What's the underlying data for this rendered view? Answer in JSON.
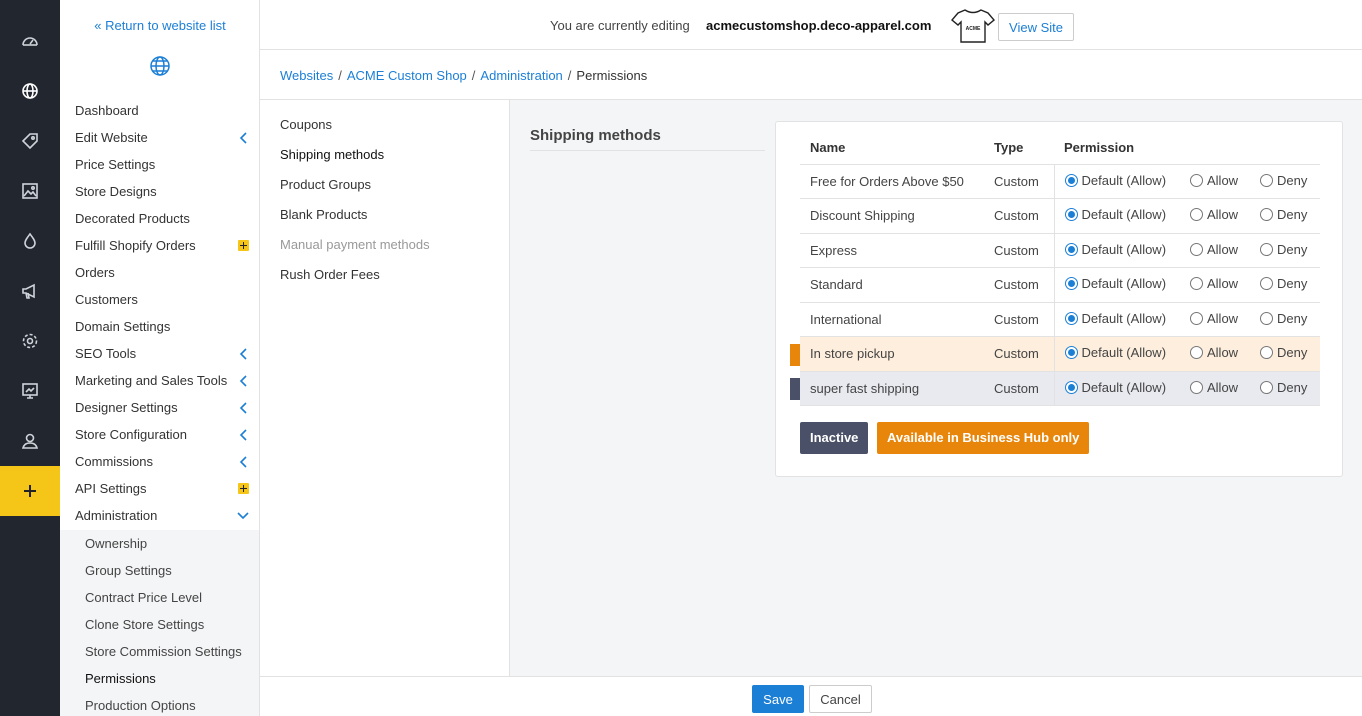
{
  "colors": {
    "accent": "#1c7fd6",
    "rail": "#22262e",
    "highlight": "#f5c518",
    "orange": "#e8860c",
    "slate": "#4a5068"
  },
  "rail": {
    "icons": [
      "dashboard-icon",
      "globe-icon",
      "tag-icon",
      "image-icon",
      "drop-icon",
      "megaphone-icon",
      "gear-icon",
      "chart-board-icon",
      "user-icon",
      "plus-icon"
    ]
  },
  "sidebar": {
    "return_link": "« Return to website list",
    "items": [
      {
        "label": "Dashboard"
      },
      {
        "label": "Edit Website"
      },
      {
        "label": "Price Settings"
      },
      {
        "label": "Store Designs"
      },
      {
        "label": "Decorated Products"
      },
      {
        "label": "Fulfill Shopify Orders"
      },
      {
        "label": "Orders"
      },
      {
        "label": "Customers"
      },
      {
        "label": "Domain Settings"
      },
      {
        "label": "SEO Tools"
      },
      {
        "label": "Marketing and Sales Tools"
      },
      {
        "label": "Designer Settings"
      },
      {
        "label": "Store Configuration"
      },
      {
        "label": "Commissions"
      },
      {
        "label": "API Settings"
      },
      {
        "label": "Administration"
      }
    ],
    "sub_items": [
      {
        "label": "Ownership"
      },
      {
        "label": "Group Settings"
      },
      {
        "label": "Contract Price Level"
      },
      {
        "label": "Clone Store Settings"
      },
      {
        "label": "Store Commission Settings"
      },
      {
        "label": "Permissions"
      },
      {
        "label": "Production Options"
      }
    ]
  },
  "topbar": {
    "editing_text": "You are currently editing",
    "domain": "acmecustomshop.deco-apparel.com",
    "shirt_text": "ACME",
    "view_site": "View Site"
  },
  "breadcrumb": {
    "items": [
      "Websites",
      "ACME Custom Shop",
      "Administration"
    ],
    "separator": "/",
    "current": "Permissions"
  },
  "categories": [
    {
      "label": "Coupons"
    },
    {
      "label": "Shipping methods"
    },
    {
      "label": "Product Groups"
    },
    {
      "label": "Blank Products"
    },
    {
      "label": "Manual payment methods"
    },
    {
      "label": "Rush Order Fees"
    }
  ],
  "section_title": "Shipping methods",
  "table": {
    "headers": {
      "name": "Name",
      "type": "Type",
      "permission": "Permission"
    },
    "options": {
      "default": "Default (Allow)",
      "allow": "Allow",
      "deny": "Deny"
    },
    "rows": [
      {
        "name": "Free for Orders Above $50",
        "type": "Custom",
        "selected": "default"
      },
      {
        "name": "Discount Shipping",
        "type": "Custom",
        "selected": "default"
      },
      {
        "name": "Express",
        "type": "Custom",
        "selected": "default"
      },
      {
        "name": "Standard",
        "type": "Custom",
        "selected": "default"
      },
      {
        "name": "International",
        "type": "Custom",
        "selected": "default"
      },
      {
        "name": "In store pickup",
        "type": "Custom",
        "selected": "default",
        "status": "hub-only"
      },
      {
        "name": "super fast shipping",
        "type": "Custom",
        "selected": "default",
        "status": "inactive"
      }
    ]
  },
  "legend": {
    "inactive": "Inactive",
    "hub_only": "Available in Business Hub only"
  },
  "footer": {
    "save": "Save",
    "cancel": "Cancel"
  }
}
